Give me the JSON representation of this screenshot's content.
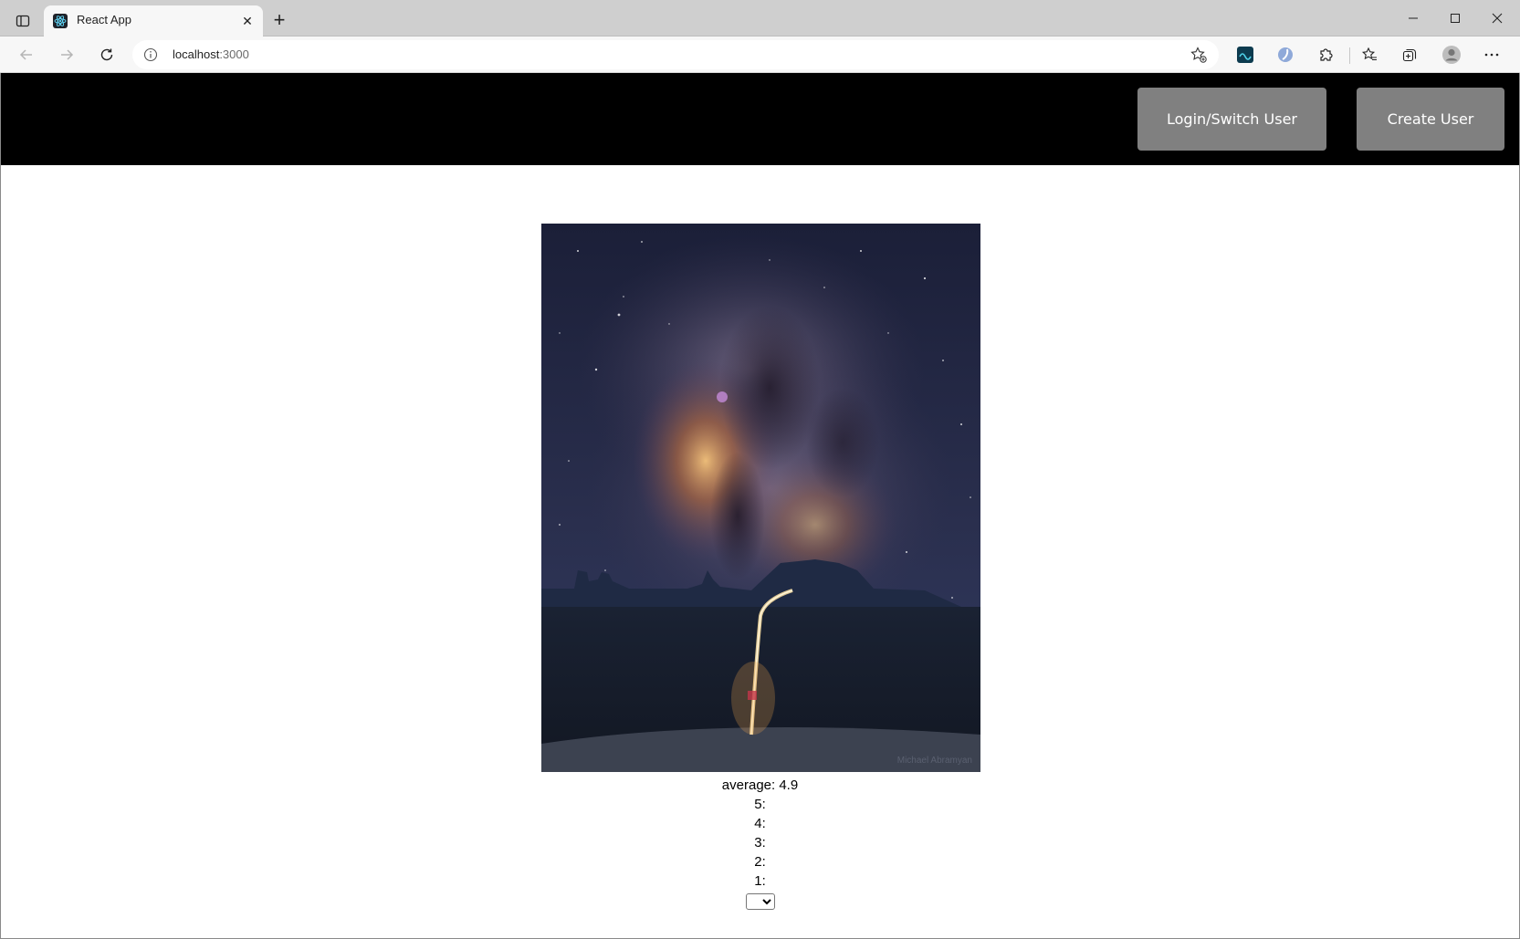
{
  "browser": {
    "tab_title": "React App",
    "url_host": "localhost",
    "url_port": ":3000"
  },
  "header": {
    "login_label": "Login/Switch User",
    "create_label": "Create User"
  },
  "photo": {
    "caption_watermark": "Michael Abramyan"
  },
  "ratings": {
    "average_label": "average: 4.9",
    "rows": [
      "5:",
      "4:",
      "3:",
      "2:",
      "1:"
    ],
    "select_value": ""
  },
  "colors": {
    "header_bg": "#000000",
    "header_button_bg": "#808080",
    "page_bg": "#ffffff"
  }
}
